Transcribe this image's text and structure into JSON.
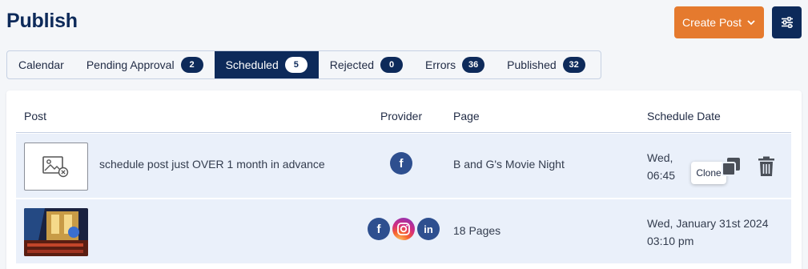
{
  "header": {
    "title": "Publish",
    "create_label": "Create Post"
  },
  "tabs": [
    {
      "label": "Calendar",
      "count": ""
    },
    {
      "label": "Pending Approval",
      "count": "2"
    },
    {
      "label": "Scheduled",
      "count": "5"
    },
    {
      "label": "Rejected",
      "count": "0"
    },
    {
      "label": "Errors",
      "count": "36"
    },
    {
      "label": "Published",
      "count": "32"
    }
  ],
  "table": {
    "columns": {
      "post": "Post",
      "provider": "Provider",
      "page": "Page",
      "schedule": "Schedule Date"
    },
    "rows": [
      {
        "text": "schedule post just OVER 1 month in advance",
        "providers": [
          "facebook"
        ],
        "page": "B and G's Movie Night",
        "date_line1": "Wed,",
        "date_line2": "06:45"
      },
      {
        "text": "",
        "providers": [
          "facebook",
          "instagram",
          "linkedin"
        ],
        "page": "18 Pages",
        "date_line1": "Wed, January 31st 2024",
        "date_line2": "03:10 pm"
      }
    ]
  },
  "tooltip": "Clone",
  "colors": {
    "primary": "#0d2a5a",
    "accent": "#e57a2e",
    "row_bg": "#eaf0fa"
  },
  "icons": [
    "chevron-down-icon",
    "sliders-icon",
    "image-placeholder-icon",
    "facebook-icon",
    "instagram-icon",
    "linkedin-icon",
    "clone-icon",
    "trash-icon"
  ]
}
